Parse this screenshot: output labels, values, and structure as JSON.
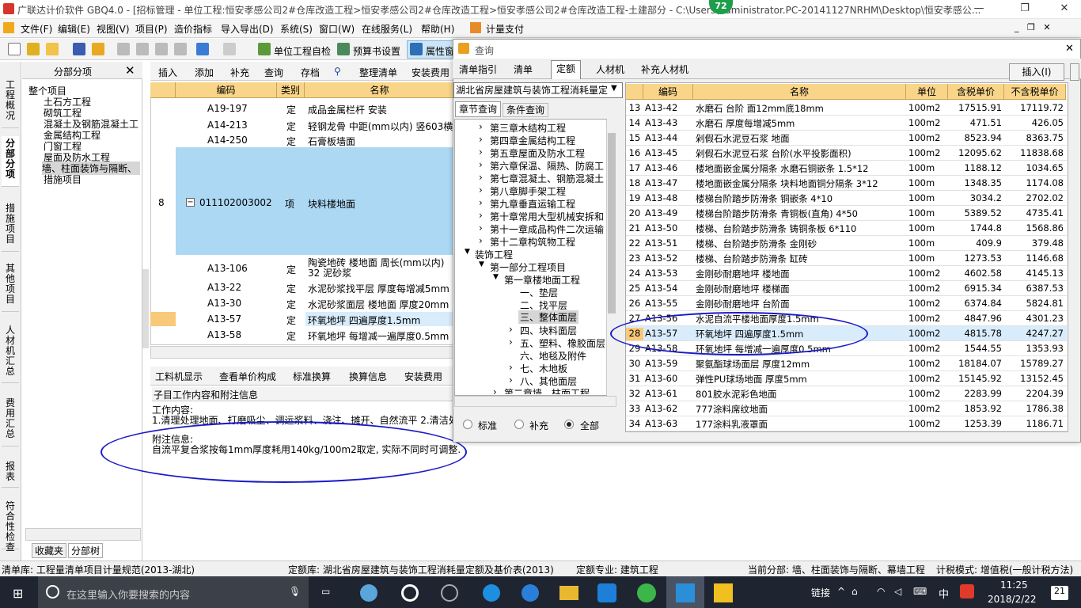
{
  "window": {
    "title": "广联达计价软件 GBQ4.0 - [招标管理 - 单位工程:恒安孝感公司2#仓库改造工程>恒安孝感公司2#仓库改造工程>恒安孝感公司2#仓库改造工程-土建部分 - C:\\Users\\Administrator.PC-20141127NRHM\\Desktop\\恒安孝感公...",
    "badge": "72"
  },
  "menu": [
    "文件(F)",
    "编辑(E)",
    "视图(V)",
    "项目(P)",
    "造价指标",
    "导入导出(D)",
    "系统(S)",
    "窗口(W)",
    "在线服务(L)",
    "帮助(H)",
    "计量支付"
  ],
  "toolbar": {
    "check": "单位工程自检",
    "budget": "预算书设置",
    "prop": "属性窗"
  },
  "vtabs": [
    "工程概况",
    "分部分项",
    "措施项目",
    "其他项目",
    "人材机汇总",
    "费用汇总",
    "报表",
    "符合性检查"
  ],
  "leftpane": {
    "title": "分部分项",
    "items": [
      "整个项目",
      "土石方工程",
      "砌筑工程",
      "混凝土及钢筋混凝土工",
      "金属结构工程",
      "门窗工程",
      "屋面及防水工程",
      "墙、柱面装饰与隔断、",
      "措施项目"
    ],
    "bottomtabs": [
      "收藏夹",
      "分部树"
    ]
  },
  "toolbar2": [
    "插入",
    "添加",
    "补充",
    "查询",
    "存档",
    "整理清单",
    "安装费用"
  ],
  "grid": {
    "headers": [
      "编码",
      "类别",
      "名称"
    ],
    "rows": [
      {
        "n": "",
        "code": "A19-197",
        "type": "定",
        "name": "成品金属栏杆 安装"
      },
      {
        "n": "",
        "code": "A14-213",
        "type": "定",
        "name": "轻钢龙骨 中距(mm以内) 竖603横15"
      },
      {
        "n": "",
        "code": "A14-250",
        "type": "定",
        "name": "石膏板墙面"
      },
      {
        "n": "8",
        "code": "011102003002",
        "type": "项",
        "name": "块料楼地面"
      },
      {
        "n": "",
        "code": "A13-106",
        "type": "定",
        "name": "陶瓷地砖 楼地面 周长(mm以内) 32 泥砂浆"
      },
      {
        "n": "",
        "code": "A13-22",
        "type": "定",
        "name": "水泥砂浆找平层 厚度每增减5mm"
      },
      {
        "n": "",
        "code": "A13-30",
        "type": "定",
        "name": "水泥砂浆面层 楼地面 厚度20mm"
      },
      {
        "n": "",
        "code": "A13-57",
        "type": "定",
        "name": "环氧地坪 四遍厚度1.5mm"
      },
      {
        "n": "",
        "code": "A13-58",
        "type": "定",
        "name": "环氧地坪 每增减一遍厚度0.5mm"
      }
    ]
  },
  "dettabs": [
    "工料机显示",
    "查看单价构成",
    "标准换算",
    "换算信息",
    "安装费用"
  ],
  "detail": {
    "title": "子目工作内容和附注信息",
    "work_label": "工作内容:",
    "work": "1.清理处理地面、打磨吸尘、调运浆料、浇注、摊开、自然流平 2.清洁处",
    "note_label": "附注信息:",
    "note": "自流平复合浆按每1mm厚度耗用140kg/100m2取定, 实际不同时可调整."
  },
  "dialog": {
    "title": "查询",
    "tabs": [
      "清单指引",
      "清单",
      "定额",
      "人材机",
      "补充人材机"
    ],
    "insert": "插入(I)",
    "combo": "湖北省房屋建筑与装饰工程消耗量定",
    "subtabs": [
      "章节查询",
      "条件查询"
    ],
    "tree": [
      "第三章木结构工程",
      "第四章金属结构工程",
      "第五章屋面及防水工程",
      "第六章保温、隔热、防腐工",
      "第七章混凝土、钢筋混凝土",
      "第八章脚手架工程",
      "第九章垂直运输工程",
      "第十章常用大型机械安拆和",
      "第十一章成品构件二次运输",
      "第十二章构筑物工程",
      "装饰工程",
      "第一部分工程项目",
      "第一章楼地面工程",
      "一、垫层",
      "二、找平层",
      "三、整体面层",
      "四、块料面层",
      "五、塑料、橡胶面层",
      "六、地毯及附件",
      "七、木地板",
      "八、其他面层",
      "第二章墙、柱面工程"
    ],
    "radios": [
      "标准",
      "补充",
      "全部"
    ],
    "headers": [
      "编码",
      "名称",
      "单位",
      "含税单价",
      "不含税单价"
    ],
    "rows": [
      {
        "n": "13",
        "code": "A13-42",
        "name": "水磨石 台阶 面12mm底18mm",
        "unit": "100m2",
        "p1": "17515.91",
        "p2": "17119.72"
      },
      {
        "n": "14",
        "code": "A13-43",
        "name": "水磨石 厚度每增减5mm",
        "unit": "100m2",
        "p1": "471.51",
        "p2": "426.05"
      },
      {
        "n": "15",
        "code": "A13-44",
        "name": "剁假石水泥豆石浆 地面",
        "unit": "100m2",
        "p1": "8523.94",
        "p2": "8363.75"
      },
      {
        "n": "16",
        "code": "A13-45",
        "name": "剁假石水泥豆石浆 台阶(水平投影面积)",
        "unit": "100m2",
        "p1": "12095.62",
        "p2": "11838.68"
      },
      {
        "n": "17",
        "code": "A13-46",
        "name": "楼地面嵌金属分隔条 水磨石铜嵌条 1.5*12",
        "unit": "100m",
        "p1": "1188.12",
        "p2": "1034.65"
      },
      {
        "n": "18",
        "code": "A13-47",
        "name": "楼地面嵌金属分隔条 块料地面铜分隔条 3*12",
        "unit": "100m",
        "p1": "1348.35",
        "p2": "1174.08"
      },
      {
        "n": "19",
        "code": "A13-48",
        "name": "楼梯台阶踏步防滑条 铜嵌条 4*10",
        "unit": "100m",
        "p1": "3034.2",
        "p2": "2702.02"
      },
      {
        "n": "20",
        "code": "A13-49",
        "name": "楼梯台阶踏步防滑条 青铜板(直角) 4*50",
        "unit": "100m",
        "p1": "5389.52",
        "p2": "4735.41"
      },
      {
        "n": "21",
        "code": "A13-50",
        "name": "楼梯、台阶踏步防滑条 铸铜条板 6*110",
        "unit": "100m",
        "p1": "1744.8",
        "p2": "1568.86"
      },
      {
        "n": "22",
        "code": "A13-51",
        "name": "楼梯、台阶踏步防滑条 金刚砂",
        "unit": "100m",
        "p1": "409.9",
        "p2": "379.48"
      },
      {
        "n": "23",
        "code": "A13-52",
        "name": "楼梯、台阶踏步防滑条 缸砖",
        "unit": "100m",
        "p1": "1273.53",
        "p2": "1146.68"
      },
      {
        "n": "24",
        "code": "A13-53",
        "name": "金刚砂耐磨地坪 楼地面",
        "unit": "100m2",
        "p1": "4602.58",
        "p2": "4145.13"
      },
      {
        "n": "25",
        "code": "A13-54",
        "name": "金刚砂耐磨地坪 楼梯面",
        "unit": "100m2",
        "p1": "6915.34",
        "p2": "6387.53"
      },
      {
        "n": "26",
        "code": "A13-55",
        "name": "金刚砂耐磨地坪 台阶面",
        "unit": "100m2",
        "p1": "6374.84",
        "p2": "5824.81"
      },
      {
        "n": "27",
        "code": "A13-56",
        "name": "水泥自流平楼地面厚度1.5mm",
        "unit": "100m2",
        "p1": "4847.96",
        "p2": "4301.23"
      },
      {
        "n": "28",
        "code": "A13-57",
        "name": "环氧地坪 四遍厚度1.5mm",
        "unit": "100m2",
        "p1": "4815.78",
        "p2": "4247.27"
      },
      {
        "n": "29",
        "code": "A13-58",
        "name": "环氧地坪 每增减一遍厚度0.5mm",
        "unit": "100m2",
        "p1": "1544.55",
        "p2": "1353.93"
      },
      {
        "n": "30",
        "code": "A13-59",
        "name": "聚氨酯球场面层 厚度12mm",
        "unit": "100m2",
        "p1": "18184.07",
        "p2": "15789.27"
      },
      {
        "n": "31",
        "code": "A13-60",
        "name": "弹性PU球场地面 厚度5mm",
        "unit": "100m2",
        "p1": "15145.92",
        "p2": "13152.45"
      },
      {
        "n": "32",
        "code": "A13-61",
        "name": "801胶水泥彩色地面",
        "unit": "100m2",
        "p1": "2283.99",
        "p2": "2204.39"
      },
      {
        "n": "33",
        "code": "A13-62",
        "name": "777涂料席纹地面",
        "unit": "100m2",
        "p1": "1853.92",
        "p2": "1786.38"
      },
      {
        "n": "34",
        "code": "A13-63",
        "name": "177涂料乳液罩面",
        "unit": "100m2",
        "p1": "1253.39",
        "p2": "1186.71"
      }
    ]
  },
  "status": {
    "qd": "清单库: 工程量清单项目计量规范(2013-湖北)",
    "de": "定额库: 湖北省房屋建筑与装饰工程消耗量定额及基价表(2013)",
    "zy": "定额专业: 建筑工程",
    "fb": "当前分部: 墙、柱面装饰与隔断、幕墙工程",
    "tax": "计税模式: 增值税(一般计税方法)"
  },
  "taskbar": {
    "search": "在这里输入你要搜索的内容",
    "link": "链接",
    "ime": "中",
    "time": "11:25",
    "date": "2018/2/22",
    "notif": "21"
  }
}
